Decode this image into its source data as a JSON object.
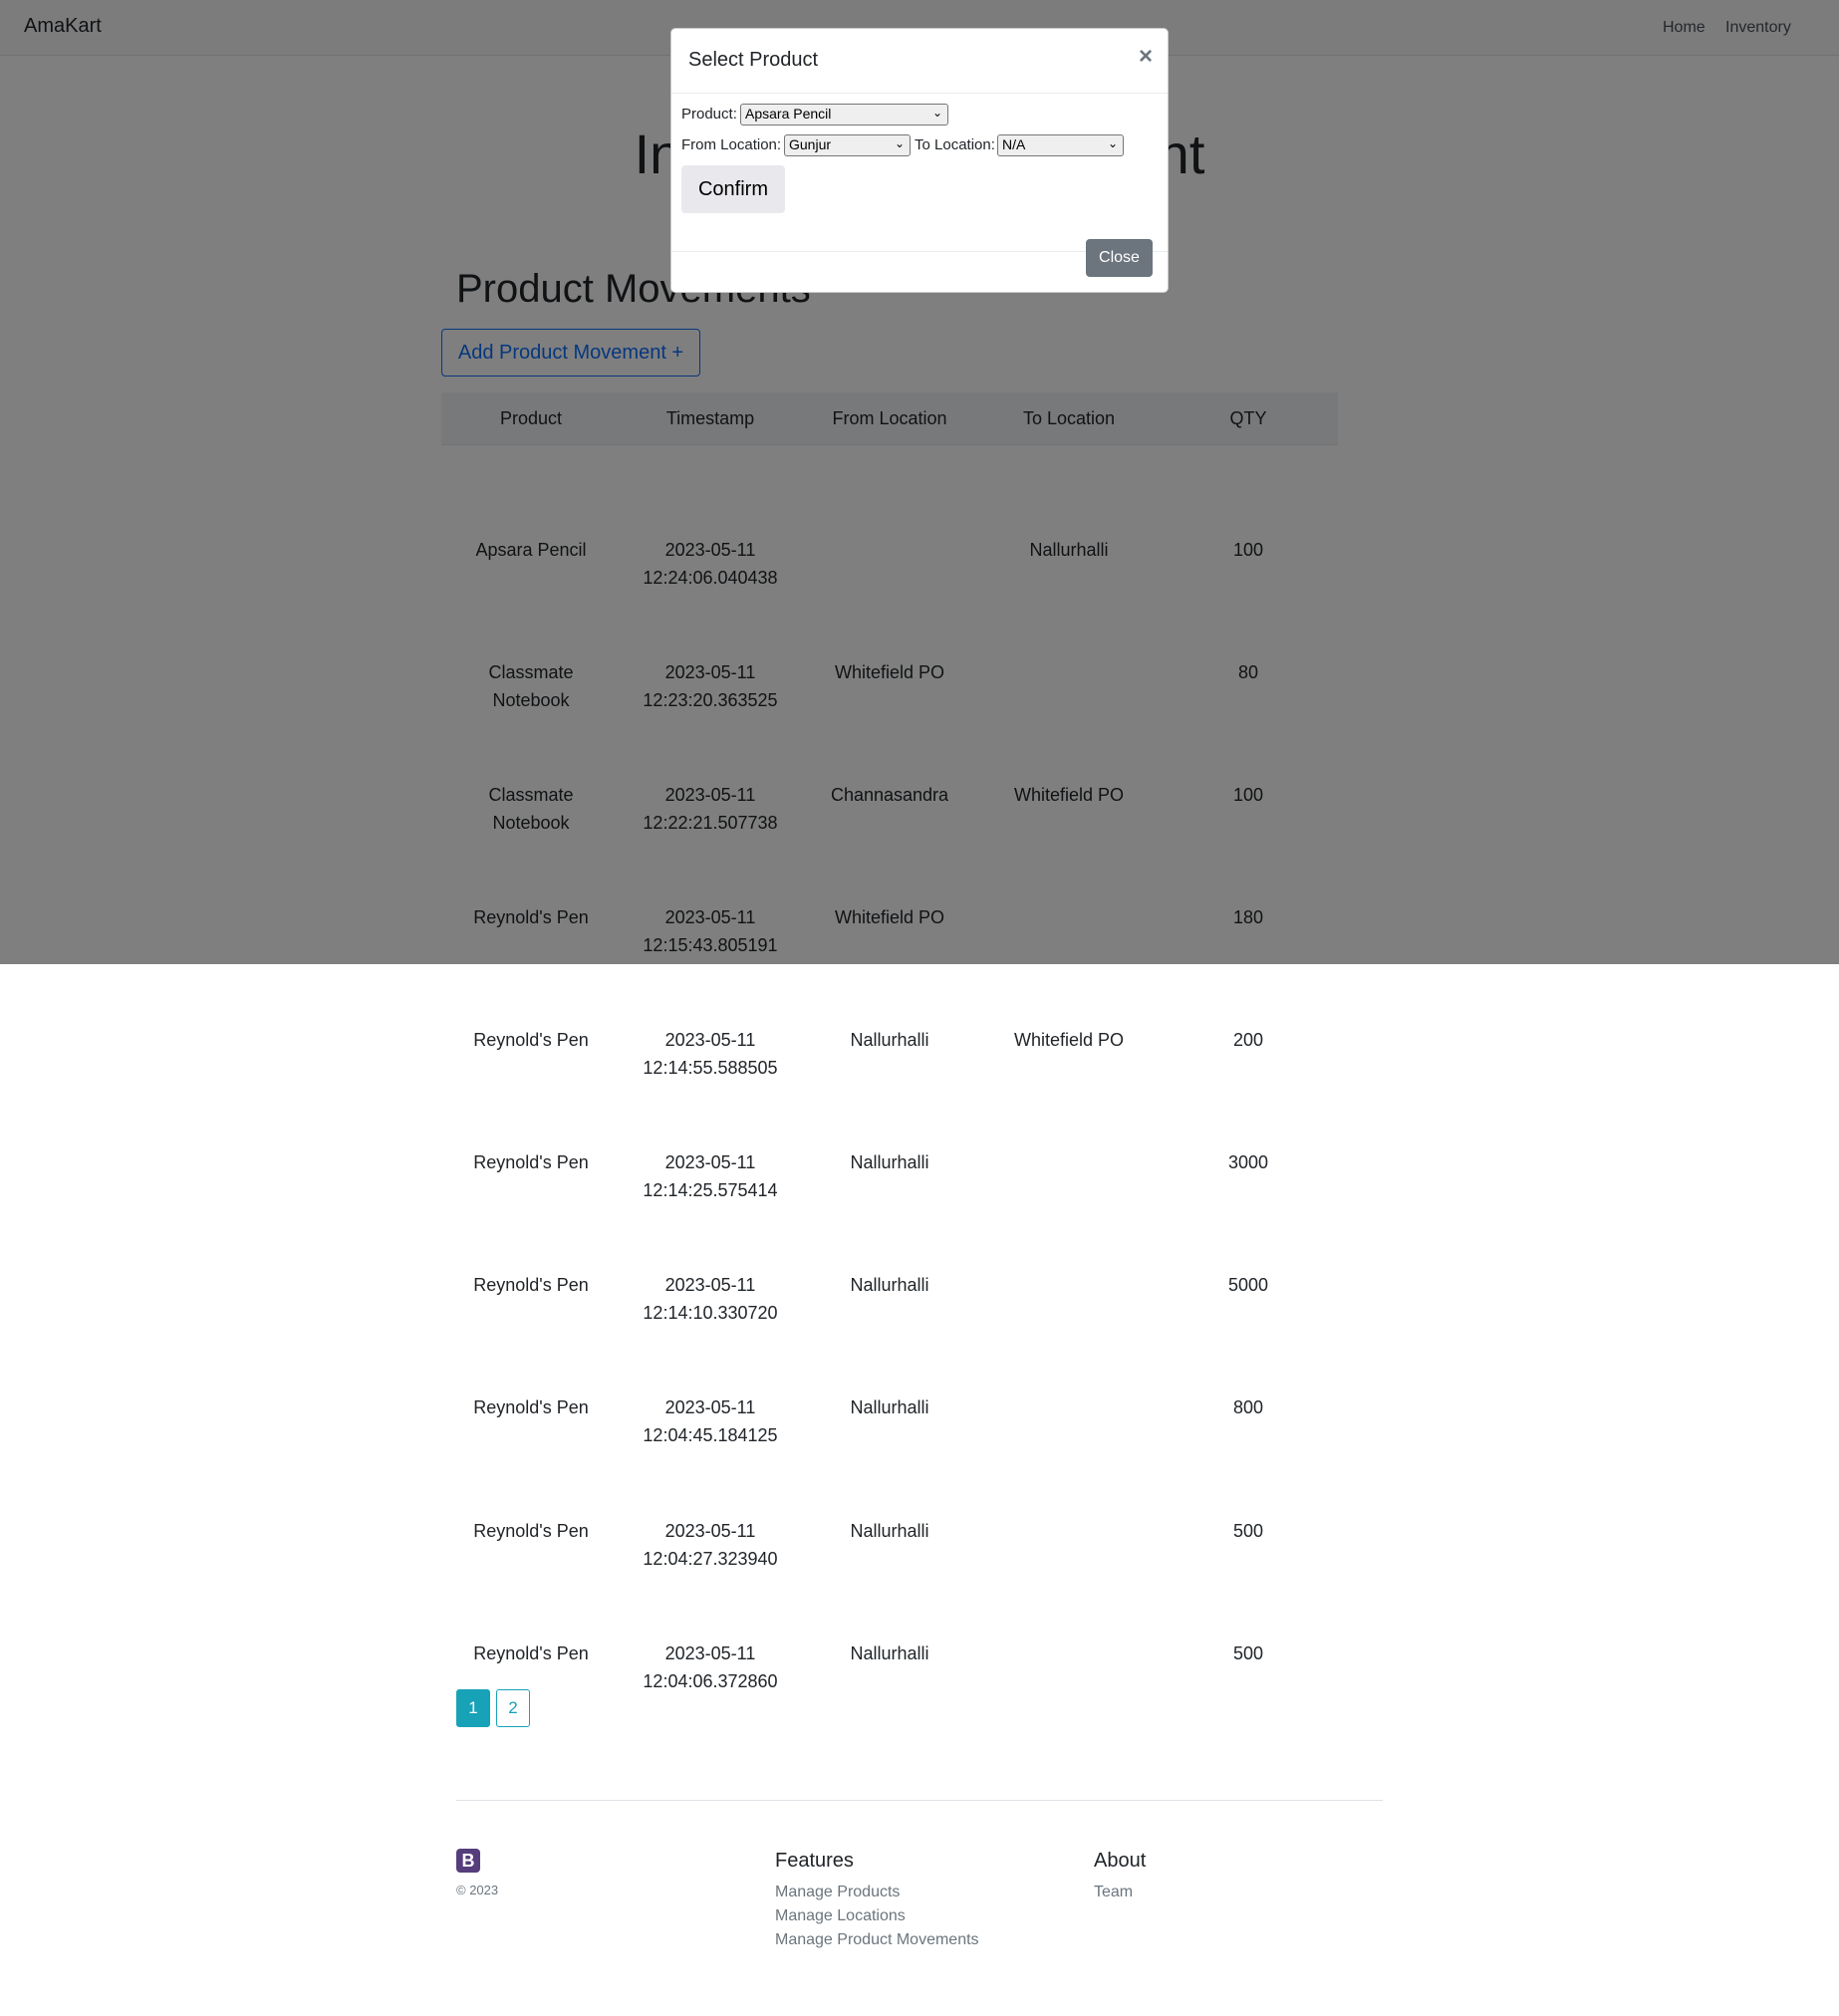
{
  "navbar": {
    "brand": "AmaKart",
    "links": [
      "Home",
      "Inventory"
    ]
  },
  "hero": {
    "title": "Inventory Management"
  },
  "section": {
    "title": "Product Movements",
    "add_button": "Add Product Movement +"
  },
  "table": {
    "headers": [
      "Product",
      "Timestamp",
      "From Location",
      "To Location",
      "QTY"
    ],
    "rows": [
      {
        "product": "Apsara Pencil",
        "date": "2023-05-11",
        "time": "12:24:06.040438",
        "from": "",
        "to": "Nallurhalli",
        "qty": "100"
      },
      {
        "product": "Classmate Notebook",
        "date": "2023-05-11",
        "time": "12:23:20.363525",
        "from": "Whitefield PO",
        "to": "",
        "qty": "80"
      },
      {
        "product": "Classmate Notebook",
        "date": "2023-05-11",
        "time": "12:22:21.507738",
        "from": "Channasandra",
        "to": "Whitefield PO",
        "qty": "100"
      },
      {
        "product": "Reynold's Pen",
        "date": "2023-05-11",
        "time": "12:15:43.805191",
        "from": "Whitefield PO",
        "to": "",
        "qty": "180"
      },
      {
        "product": "Reynold's Pen",
        "date": "2023-05-11",
        "time": "12:14:55.588505",
        "from": "Nallurhalli",
        "to": "Whitefield PO",
        "qty": "200"
      },
      {
        "product": "Reynold's Pen",
        "date": "2023-05-11",
        "time": "12:14:25.575414",
        "from": "Nallurhalli",
        "to": "",
        "qty": "3000"
      },
      {
        "product": "Reynold's Pen",
        "date": "2023-05-11",
        "time": "12:14:10.330720",
        "from": "Nallurhalli",
        "to": "",
        "qty": "5000"
      },
      {
        "product": "Reynold's Pen",
        "date": "2023-05-11",
        "time": "12:04:45.184125",
        "from": "Nallurhalli",
        "to": "",
        "qty": "800"
      },
      {
        "product": "Reynold's Pen",
        "date": "2023-05-11",
        "time": "12:04:27.323940",
        "from": "Nallurhalli",
        "to": "",
        "qty": "500"
      },
      {
        "product": "Reynold's Pen",
        "date": "2023-05-11",
        "time": "12:04:06.372860",
        "from": "Nallurhalli",
        "to": "",
        "qty": "500"
      }
    ]
  },
  "pagination": {
    "pages": [
      "1",
      "2"
    ],
    "active": "1"
  },
  "footer": {
    "logo_letter": "B",
    "copyright": "© 2023",
    "features": {
      "heading": "Features",
      "links": [
        "Manage Products",
        "Manage Locations",
        "Manage Product Movements"
      ]
    },
    "about": {
      "heading": "About",
      "links": [
        "Team"
      ]
    }
  },
  "modal": {
    "title": "Select Product",
    "close_symbol": "×",
    "product_label": "Product:",
    "product_value": "Apsara Pencil",
    "from_label": "From Location:",
    "from_value": "Gunjur",
    "to_label": "To Location:",
    "to_value": "N/A",
    "confirm_label": "Confirm",
    "close_label": "Close"
  },
  "colors": {
    "primary": "#0d6efd",
    "info": "#17a2b8",
    "secondary": "#6c757d",
    "bootstrap_purple": "#563d7c"
  }
}
